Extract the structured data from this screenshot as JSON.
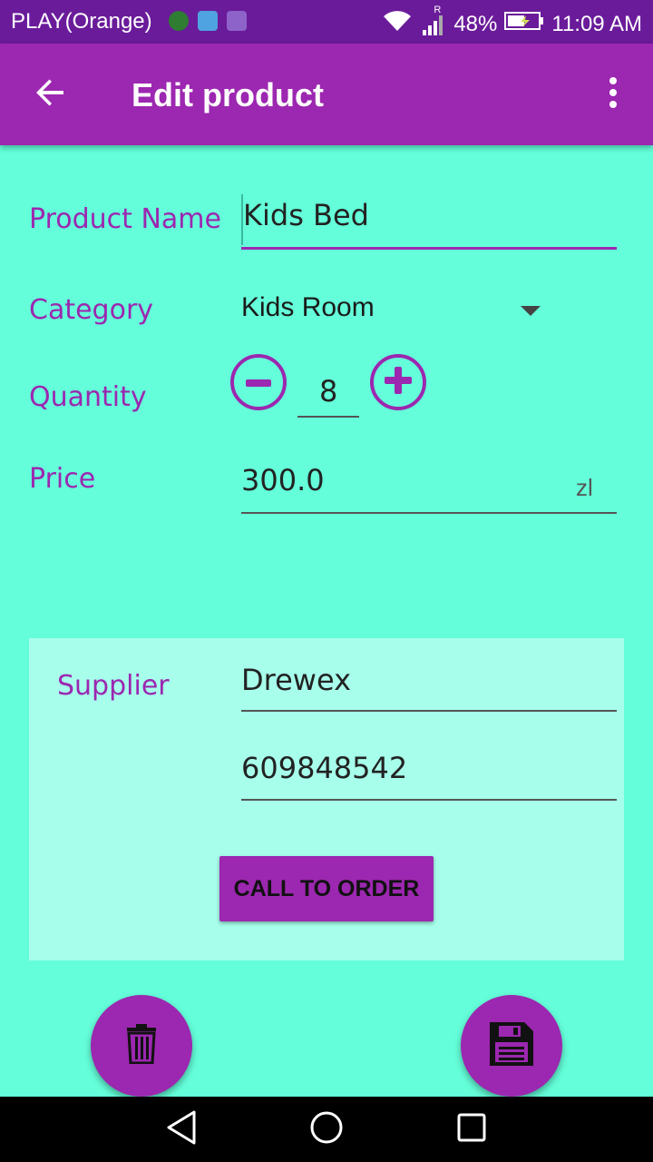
{
  "status_bar": {
    "carrier": "PLAY(Orange)",
    "signal_label": "R",
    "battery": "48%",
    "time": "11:09 AM"
  },
  "toolbar": {
    "title": "Edit product",
    "back_icon": "arrow-back-icon",
    "menu_icon": "more-vert-icon"
  },
  "form": {
    "product_name": {
      "label": "Product Name",
      "value": "Kids Bed"
    },
    "category": {
      "label": "Category",
      "value": "Kids Room"
    },
    "quantity": {
      "label": "Quantity",
      "value": "8"
    },
    "price": {
      "label": "Price",
      "value": "300.0",
      "currency": "zl"
    }
  },
  "supplier": {
    "label": "Supplier",
    "name": "Drewex",
    "phone": "609848542",
    "call_button": "CALL TO ORDER"
  },
  "fabs": {
    "delete_icon": "trash-icon",
    "save_icon": "floppy-disk-icon"
  },
  "colors": {
    "background": "#64FFDA",
    "accent": "#9C27B0",
    "status_bar": "#6A1B9A",
    "panel": "#A7FFEB"
  }
}
